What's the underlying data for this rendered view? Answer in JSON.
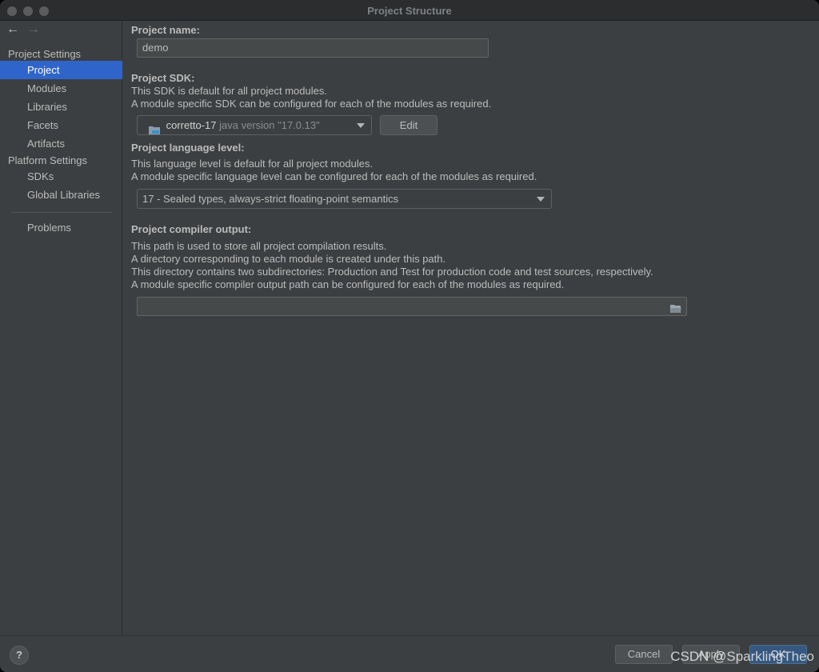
{
  "window": {
    "title": "Project Structure"
  },
  "nav": {
    "back": "←",
    "forward": "→"
  },
  "sidebar": {
    "project_settings": "Project Settings",
    "items_project": [
      "Project",
      "Modules",
      "Libraries",
      "Facets",
      "Artifacts"
    ],
    "platform_settings": "Platform Settings",
    "items_platform": [
      "SDKs",
      "Global Libraries"
    ],
    "problems": "Problems",
    "selected": "Project"
  },
  "main": {
    "project_name_label": "Project name:",
    "project_name_value": "demo",
    "sdk_label": "Project SDK:",
    "sdk_desc1": "This SDK is default for all project modules.",
    "sdk_desc2": "A module specific SDK can be configured for each of the modules as required.",
    "sdk_name": "corretto-17",
    "sdk_version": "java version \"17.0.13\"",
    "edit_label": "Edit",
    "lang_label": "Project language level:",
    "lang_desc1": "This language level is default for all project modules.",
    "lang_desc2": "A module specific language level can be configured for each of the modules as required.",
    "lang_value": "17 - Sealed types, always-strict floating-point semantics",
    "compiler_label": "Project compiler output:",
    "compiler_desc1": "This path is used to store all project compilation results.",
    "compiler_desc2": "A directory corresponding to each module is created under this path.",
    "compiler_desc3": "This directory contains two subdirectories: Production and Test for production code and test sources, respectively.",
    "compiler_desc4": "A module specific compiler output path can be configured for each of the modules as required.",
    "compiler_value": ""
  },
  "bottom": {
    "help": "?",
    "cancel": "Cancel",
    "apply": "Apply",
    "ok": "OK",
    "watermark": "CSDN @SparklingTheo"
  },
  "colors": {
    "selection": "#2f65ca",
    "background": "#3c3f41"
  }
}
